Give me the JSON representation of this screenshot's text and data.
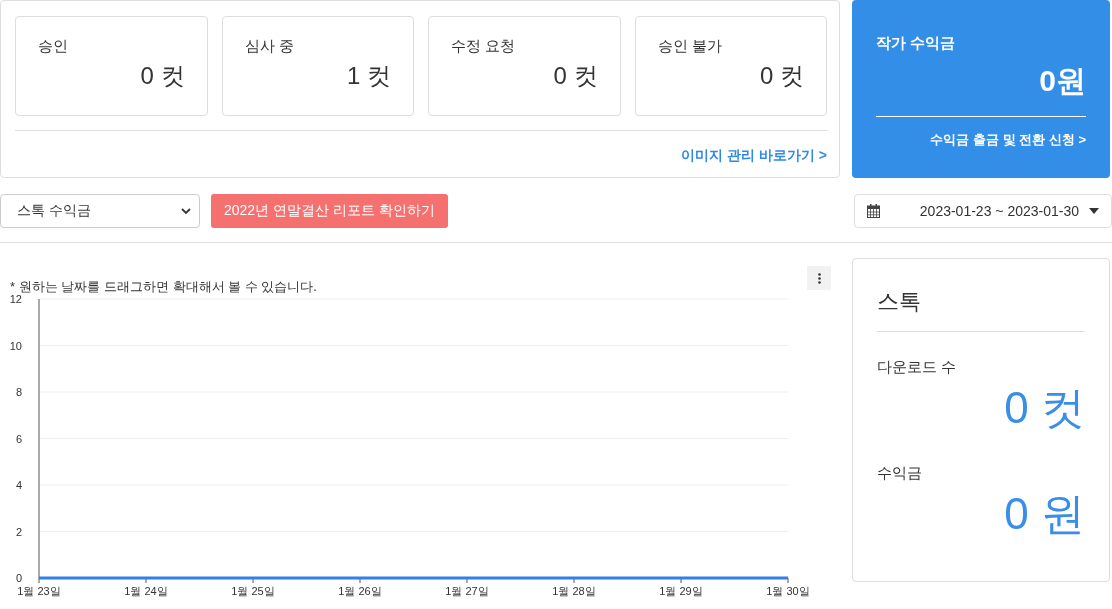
{
  "status_cards": [
    {
      "label": "승인",
      "value": "0 컷"
    },
    {
      "label": "심사 중",
      "value": "1 컷"
    },
    {
      "label": "수정 요청",
      "value": "0 컷"
    },
    {
      "label": "승인 불가",
      "value": "0 컷"
    }
  ],
  "image_link": "이미지 관리 바로가기 >",
  "earnings_card": {
    "title": "작가 수익금",
    "amount": "0원",
    "link": "수익금 출금 및 전환 신청 >"
  },
  "type_select": {
    "value": "스톡 수익금"
  },
  "report_button": "2022년 연말결산 리포트 확인하기",
  "date_range": {
    "value": "2023-01-23 ~ 2023-01-30"
  },
  "chart": {
    "note": "* 원하는 날짜를 드래그하면 확대해서 볼 수 있습니다.",
    "chart_data": {
      "type": "line",
      "categories": [
        "1월 23일",
        "1월 24일",
        "1월 25일",
        "1월 26일",
        "1월 27일",
        "1월 28일",
        "1월 29일",
        "1월 30일"
      ],
      "series": [
        {
          "color": "#2f80ed",
          "values": [
            0,
            0,
            0,
            0,
            0,
            0,
            0,
            0
          ]
        }
      ],
      "grid": true,
      "ylim": [
        0,
        12
      ],
      "yticks": [
        0,
        2,
        4,
        6,
        8,
        10,
        12
      ]
    }
  },
  "stock_panel": {
    "title": "스톡",
    "stats": [
      {
        "label": "다운로드 수",
        "value": "0 컷"
      },
      {
        "label": "수익금",
        "value": "0 원"
      }
    ]
  }
}
